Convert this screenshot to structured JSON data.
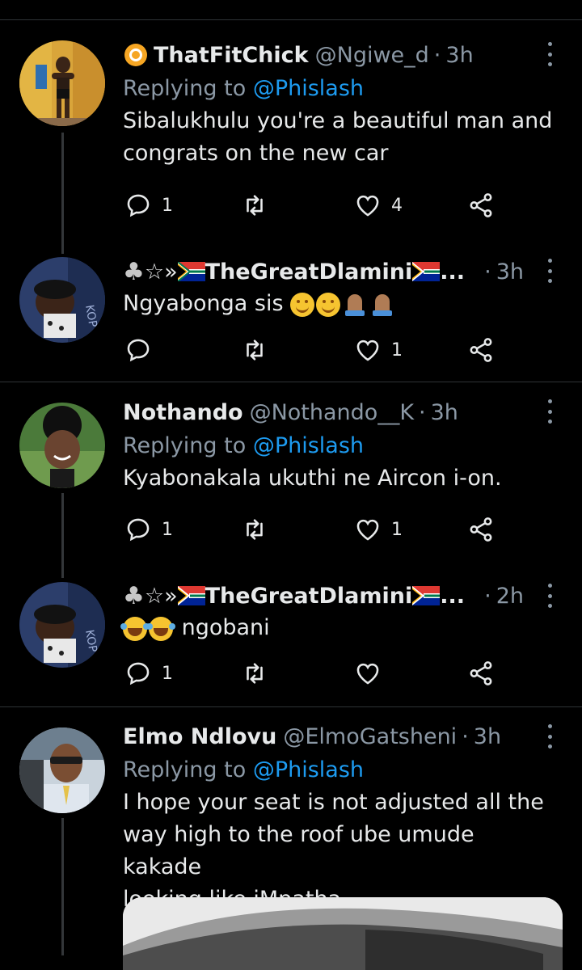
{
  "tweets": [
    {
      "name": "ThatFitChick",
      "name_prefix_icon": "sun-icon",
      "handle": "@Ngiwe_d",
      "time": "3h",
      "replying_label": "Replying to",
      "replying_to": "@Phislash",
      "text_lines": [
        "Sibalukhulu you're a beautiful man and",
        "congrats on the new car"
      ],
      "reply_count": "1",
      "retweet_count": "",
      "like_count": "4"
    },
    {
      "name": "♣☆»🇿🇦TheGreatDlamini🇿🇦...",
      "name_prefix": "♣☆»",
      "name_core": "TheGreatDlamini",
      "ellipsis": "...",
      "time": "3h",
      "text": "Ngyabonga sis",
      "reply_count": "",
      "retweet_count": "",
      "like_count": "1"
    },
    {
      "name": "Nothando",
      "handle": "@Nothando__K",
      "time": "3h",
      "replying_label": "Replying to",
      "replying_to": "@Phislash",
      "text": "Kyabonakala ukuthi ne Aircon i-on.",
      "reply_count": "1",
      "retweet_count": "",
      "like_count": "1"
    },
    {
      "name_prefix": "♣☆»",
      "name_core": "TheGreatDlamini",
      "ellipsis": "...",
      "time": "2h",
      "text": "ngobani",
      "reply_count": "1",
      "retweet_count": "",
      "like_count": ""
    },
    {
      "name": "Elmo Ndlovu",
      "handle": "@ElmoGatsheni",
      "time": "3h",
      "replying_label": "Replying to",
      "replying_to": "@Phislash",
      "text_lines": [
        "I hope your seat is not adjusted all the",
        "way high to the roof ube umude kakade",
        "looking like iMpatha . . ."
      ]
    }
  ],
  "dot": "·",
  "colors": {
    "background": "#000000",
    "text": "#e7e9ea",
    "muted": "#8b98a5",
    "link": "#1d9bf0",
    "divider": "#2f3336"
  }
}
